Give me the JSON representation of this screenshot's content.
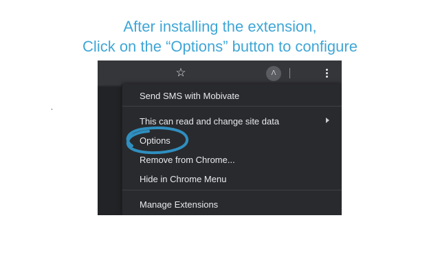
{
  "headline": {
    "line1": "After installing the extension,",
    "line2": "Click on the “Options” button to configure"
  },
  "toolbar": {
    "star_glyph": "☆",
    "extension_badge": "Λ"
  },
  "menu": {
    "items": [
      "Send SMS with Mobivate",
      "This can read and change site data",
      "Options",
      "Remove from Chrome...",
      "Hide in Chrome Menu",
      "Manage Extensions"
    ]
  },
  "colors": {
    "headline": "#3fa6d6",
    "highlight_circle": "#2f8fc0",
    "menu_bg": "#292a2d",
    "toolbar_bg": "#35363a"
  }
}
